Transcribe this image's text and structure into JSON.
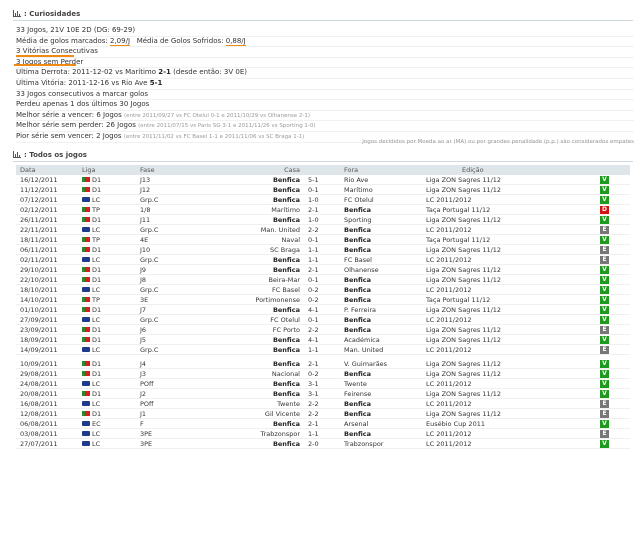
{
  "curiosidades": {
    "title": ": Curiosidades",
    "record": "33 Jogos, 21V 10E 2D (DG: 69-29)",
    "avg_scored_label": "Média de golos marcados:",
    "avg_scored": "2,09/J",
    "avg_conceded_label": "Média de Golos Sofridos:",
    "avg_conceded": "0,88/J",
    "consecutive_wins": "3 Vitórias Consecutivas",
    "unbeaten": "3 Jogos sem Perder",
    "last_loss_label": "Última Derrota: 2011-12-02 vs Marítimo",
    "last_loss_score": "2-1",
    "last_loss_since": "(desde então: 3V 0E)",
    "last_win_label": "Última Vitória: 2011-12-16 vs Rio Ave",
    "last_win_score": "5-1",
    "scoring_streak": "33 Jogos consecutivos a marcar golos",
    "lost_one": "Perdeu apenas 1 dos últimos 30 Jogos",
    "best_win_label": "Melhor série a vencer:",
    "best_win_value": "6 Jogos",
    "best_win_detail": "(entre 2011/09/27 vs FC Otelul 0-1 e 2011/10/29 vs Olhanense 2-1)",
    "best_unbeaten_label": "Melhor série sem perder:",
    "best_unbeaten_value": "26 Jogos",
    "best_unbeaten_detail": "(entre 2011/07/15 vs Paris SG 3-1 e 2011/11/26 vs Sporting 1-0)",
    "worst_label": "Pior série sem vencer:",
    "worst_value": "2 Jogos",
    "worst_detail": "(entre 2011/11/02 vs FC Basel 1-1 e 2011/11/06 vs SC Braga 1-1)"
  },
  "note": "Jogos decididos por Moeda ao ar (MA) ou por grandes penalidade (p.p.) são considerados empates",
  "todos": {
    "title": ": Todos os jogos",
    "columns": [
      "Data",
      "Liga",
      "Fase",
      "Casa",
      "",
      "Fora",
      "Edição",
      ""
    ],
    "rows": [
      {
        "date": "16/12/2011",
        "flag": "pt",
        "liga": "D1",
        "fase": "J13",
        "home": "Benfica",
        "score": "5-1",
        "away": "Rio Ave",
        "ed": "Liga ZON Sagres 11/12",
        "res": "V"
      },
      {
        "date": "11/12/2011",
        "flag": "pt",
        "liga": "D1",
        "fase": "J12",
        "home": "Benfica",
        "score": "0-1",
        "away": "Marítimo",
        "ed": "Liga ZON Sagres 11/12",
        "res": "V"
      },
      {
        "date": "07/12/2011",
        "flag": "eu",
        "liga": "LC",
        "fase": "Grp.C",
        "home": "Benfica",
        "score": "1-0",
        "away": "FC Otelul",
        "ed": "LC 2011/2012",
        "res": "V"
      },
      {
        "date": "02/12/2011",
        "flag": "pt",
        "liga": "TP",
        "fase": "1/8",
        "home": "Marítimo",
        "score": "2-1",
        "away": "Benfica",
        "ed": "Taça Portugal 11/12",
        "res": "D"
      },
      {
        "date": "26/11/2011",
        "flag": "pt",
        "liga": "D1",
        "fase": "J11",
        "home": "Benfica",
        "score": "1-0",
        "away": "Sporting",
        "ed": "Liga ZON Sagres 11/12",
        "res": "V"
      },
      {
        "date": "22/11/2011",
        "flag": "eu",
        "liga": "LC",
        "fase": "Grp.C",
        "home": "Man. United",
        "score": "2-2",
        "away": "Benfica",
        "ed": "LC 2011/2012",
        "res": "E"
      },
      {
        "date": "18/11/2011",
        "flag": "pt",
        "liga": "TP",
        "fase": "4E",
        "home": "Naval",
        "score": "0-1",
        "away": "Benfica",
        "ed": "Taça Portugal 11/12",
        "res": "V"
      },
      {
        "date": "06/11/2011",
        "flag": "pt",
        "liga": "D1",
        "fase": "J10",
        "home": "SC Braga",
        "score": "1-1",
        "away": "Benfica",
        "ed": "Liga ZON Sagres 11/12",
        "res": "E"
      },
      {
        "date": "02/11/2011",
        "flag": "eu",
        "liga": "LC",
        "fase": "Grp.C",
        "home": "Benfica",
        "score": "1-1",
        "away": "FC Basel",
        "ed": "LC 2011/2012",
        "res": "E"
      },
      {
        "date": "29/10/2011",
        "flag": "pt",
        "liga": "D1",
        "fase": "J9",
        "home": "Benfica",
        "score": "2-1",
        "away": "Olhanense",
        "ed": "Liga ZON Sagres 11/12",
        "res": "V"
      },
      {
        "date": "22/10/2011",
        "flag": "pt",
        "liga": "D1",
        "fase": "J8",
        "home": "Beira-Mar",
        "score": "0-1",
        "away": "Benfica",
        "ed": "Liga ZON Sagres 11/12",
        "res": "V"
      },
      {
        "date": "18/10/2011",
        "flag": "eu",
        "liga": "LC",
        "fase": "Grp.C",
        "home": "FC Basel",
        "score": "0-2",
        "away": "Benfica",
        "ed": "LC 2011/2012",
        "res": "V"
      },
      {
        "date": "14/10/2011",
        "flag": "pt",
        "liga": "TP",
        "fase": "3E",
        "home": "Portimonense",
        "score": "0-2",
        "away": "Benfica",
        "ed": "Taça Portugal 11/12",
        "res": "V"
      },
      {
        "date": "01/10/2011",
        "flag": "pt",
        "liga": "D1",
        "fase": "J7",
        "home": "Benfica",
        "score": "4-1",
        "away": "P. Ferreira",
        "ed": "Liga ZON Sagres 11/12",
        "res": "V"
      },
      {
        "date": "27/09/2011",
        "flag": "eu",
        "liga": "LC",
        "fase": "Grp.C",
        "home": "FC Otelul",
        "score": "0-1",
        "away": "Benfica",
        "ed": "LC 2011/2012",
        "res": "V"
      },
      {
        "date": "23/09/2011",
        "flag": "pt",
        "liga": "D1",
        "fase": "J6",
        "home": "FC Porto",
        "score": "2-2",
        "away": "Benfica",
        "ed": "Liga ZON Sagres 11/12",
        "res": "E"
      },
      {
        "date": "18/09/2011",
        "flag": "pt",
        "liga": "D1",
        "fase": "J5",
        "home": "Benfica",
        "score": "4-1",
        "away": "Académica",
        "ed": "Liga ZON Sagres 11/12",
        "res": "V"
      },
      {
        "date": "14/09/2011",
        "flag": "eu",
        "liga": "LC",
        "fase": "Grp.C",
        "home": "Benfica",
        "score": "1-1",
        "away": "Man. United",
        "ed": "LC 2011/2012",
        "res": "E"
      },
      {
        "gap": true
      },
      {
        "date": "10/09/2011",
        "flag": "pt",
        "liga": "D1",
        "fase": "J4",
        "home": "Benfica",
        "score": "2-1",
        "away": "V. Guimarães",
        "ed": "Liga ZON Sagres 11/12",
        "res": "V"
      },
      {
        "date": "29/08/2011",
        "flag": "pt",
        "liga": "D1",
        "fase": "J3",
        "home": "Nacional",
        "score": "0-2",
        "away": "Benfica",
        "ed": "Liga ZON Sagres 11/12",
        "res": "V"
      },
      {
        "date": "24/08/2011",
        "flag": "eu",
        "liga": "LC",
        "fase": "POff",
        "home": "Benfica",
        "score": "3-1",
        "away": "Twente",
        "ed": "LC 2011/2012",
        "res": "V"
      },
      {
        "date": "20/08/2011",
        "flag": "pt",
        "liga": "D1",
        "fase": "J2",
        "home": "Benfica",
        "score": "3-1",
        "away": "Feirense",
        "ed": "Liga ZON Sagres 11/12",
        "res": "V"
      },
      {
        "date": "16/08/2011",
        "flag": "eu",
        "liga": "LC",
        "fase": "POff",
        "home": "Twente",
        "score": "2-2",
        "away": "Benfica",
        "ed": "LC 2011/2012",
        "res": "E"
      },
      {
        "date": "12/08/2011",
        "flag": "pt",
        "liga": "D1",
        "fase": "J1",
        "home": "Gil Vicente",
        "score": "2-2",
        "away": "Benfica",
        "ed": "Liga ZON Sagres 11/12",
        "res": "E"
      },
      {
        "date": "06/08/2011",
        "flag": "eu",
        "liga": "EC",
        "fase": "F",
        "home": "Benfica",
        "score": "2-1",
        "away": "Arsenal",
        "ed": "Eusébio Cup 2011",
        "res": "V"
      },
      {
        "date": "03/08/2011",
        "flag": "eu",
        "liga": "LC",
        "fase": "3PE",
        "home": "Trabzonspor",
        "score": "1-1",
        "away": "Benfica",
        "ed": "LC 2011/2012",
        "res": "E"
      },
      {
        "date": "27/07/2011",
        "flag": "eu",
        "liga": "LC",
        "fase": "3PE",
        "home": "Benfica",
        "score": "2-0",
        "away": "Trabzonspor",
        "ed": "LC 2011/2012",
        "res": "V"
      }
    ]
  },
  "colors": {
    "accent": "#f08a12",
    "win": "#1f9a1f",
    "draw": "#777777",
    "loss": "#d21414",
    "header_bg": "#dfe6ea"
  },
  "icons": {
    "section": "bar-chart-icon",
    "flag_pt": "portugal-flag-icon",
    "flag_eu": "uefa-icon"
  }
}
